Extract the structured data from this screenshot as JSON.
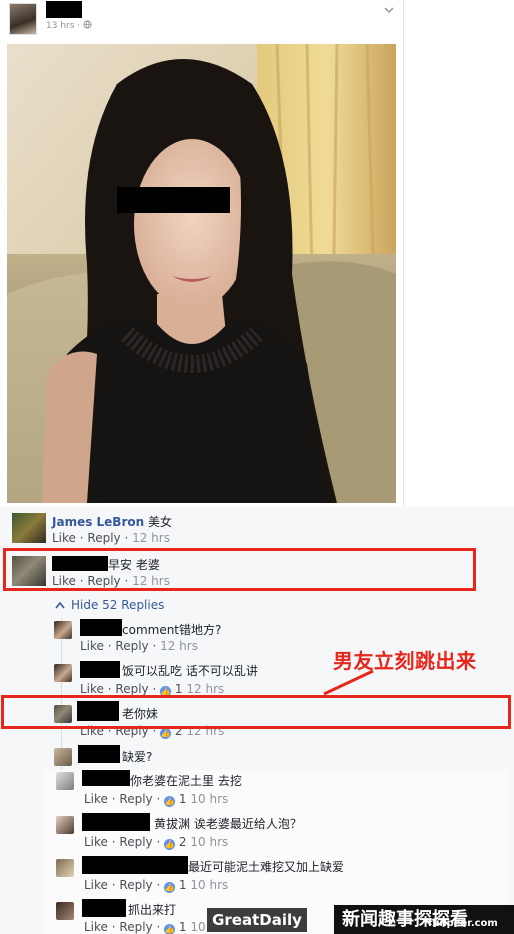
{
  "post": {
    "time": "13 hrs",
    "privacy_icon": "globe-icon"
  },
  "comments": [
    {
      "name": "James LeBron",
      "text": "美女",
      "like": "Like",
      "reply": "Reply",
      "time": "12 hrs"
    },
    {
      "text": "早安 老婆",
      "like": "Like",
      "reply": "Reply",
      "time": "12 hrs"
    }
  ],
  "hide_replies": "Hide 52 Replies",
  "replies": [
    {
      "text": "comment错地方?",
      "like": "Like",
      "reply": "Reply",
      "time": "12 hrs"
    },
    {
      "text": "饭可以乱吃 话不可以乱讲",
      "like": "Like",
      "reply": "Reply",
      "likes": "1",
      "time": "12 hrs"
    },
    {
      "text": "老你妹",
      "like": "Like",
      "reply": "Reply",
      "likes": "2",
      "time": "12 hrs"
    },
    {
      "text": "缺爱?"
    },
    {
      "text": "你老婆在泥土里 去挖",
      "like": "Like",
      "reply": "Reply",
      "likes": "1",
      "time": "10 hrs"
    },
    {
      "text": "黄拔渊 诶老婆最近给人泡？",
      "like": "Like",
      "reply": "Reply",
      "likes": "2",
      "time": "10 hrs"
    },
    {
      "text": "最近可能泥土难挖又加上缺爱",
      "like": "Like",
      "reply": "Reply",
      "likes": "1",
      "time": "10 hrs"
    },
    {
      "text": "抓出来打",
      "like": "Like",
      "reply": "Reply",
      "likes": "1",
      "time": "10 hrs"
    }
  ],
  "annotation": "男友立刻跳出来",
  "watermarks": {
    "left": "GreatDaily",
    "right": "新闻趣事探探看",
    "site": "funpeer.com"
  },
  "colors": {
    "accent": "#365899",
    "annotation": "#e7271c",
    "like_badge": "#5890ff"
  }
}
